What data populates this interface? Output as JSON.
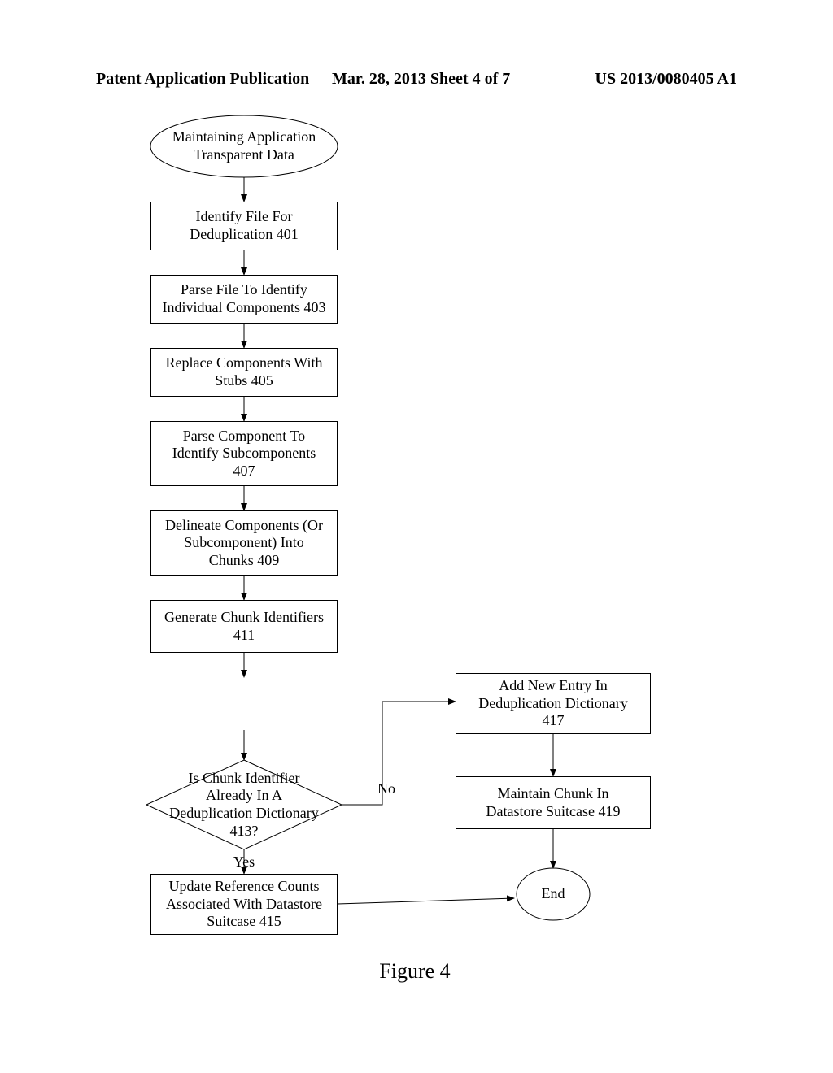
{
  "header": {
    "publication": "Patent Application Publication",
    "date_and_sheet": "Mar. 28, 2013  Sheet 4 of 7",
    "pubnum": "US 2013/0080405 A1"
  },
  "nodes": {
    "start": "Maintaining Application\nTransparent Data",
    "n401": "Identify File For\nDeduplication 401",
    "n403": "Parse File To Identify\nIndividual Components 403",
    "n405": "Replace Components With\nStubs 405",
    "n407": "Parse Component To\nIdentify Subcomponents\n407",
    "n409": "Delineate Components (Or\nSubcomponent) Into\nChunks 409",
    "n411": "Generate Chunk Identifiers\n411",
    "n413": "Is Chunk Identifier\nAlready In A\nDeduplication Dictionary\n413?",
    "n415": "Update Reference Counts\nAssociated With Datastore\nSuitcase 415",
    "n417": "Add New Entry In\nDeduplication Dictionary\n417",
    "n419": "Maintain Chunk In\nDatastore Suitcase 419",
    "end": "End"
  },
  "edges": {
    "no": "No",
    "yes": "Yes"
  },
  "caption": "Figure 4",
  "chart_data": {
    "type": "flowchart",
    "title": "Maintaining Application Transparent Data",
    "nodes": [
      {
        "id": "start",
        "shape": "terminator",
        "text": "Maintaining Application Transparent Data"
      },
      {
        "id": "401",
        "shape": "process",
        "text": "Identify File For Deduplication 401"
      },
      {
        "id": "403",
        "shape": "process",
        "text": "Parse File To Identify Individual Components 403"
      },
      {
        "id": "405",
        "shape": "process",
        "text": "Replace Components With Stubs 405"
      },
      {
        "id": "407",
        "shape": "process",
        "text": "Parse Component To Identify Subcomponents 407"
      },
      {
        "id": "409",
        "shape": "process",
        "text": "Delineate Components (Or Subcomponent) Into Chunks 409"
      },
      {
        "id": "411",
        "shape": "process",
        "text": "Generate Chunk Identifiers 411"
      },
      {
        "id": "413",
        "shape": "decision",
        "text": "Is Chunk Identifier Already In A Deduplication Dictionary 413?"
      },
      {
        "id": "415",
        "shape": "process",
        "text": "Update Reference Counts Associated With Datastore Suitcase 415"
      },
      {
        "id": "417",
        "shape": "process",
        "text": "Add New Entry In Deduplication Dictionary 417"
      },
      {
        "id": "419",
        "shape": "process",
        "text": "Maintain Chunk In Datastore Suitcase 419"
      },
      {
        "id": "end",
        "shape": "terminator",
        "text": "End"
      }
    ],
    "edges": [
      {
        "from": "start",
        "to": "401"
      },
      {
        "from": "401",
        "to": "403"
      },
      {
        "from": "403",
        "to": "405"
      },
      {
        "from": "405",
        "to": "407"
      },
      {
        "from": "407",
        "to": "409"
      },
      {
        "from": "409",
        "to": "411"
      },
      {
        "from": "411",
        "to": "413"
      },
      {
        "from": "413",
        "to": "415",
        "label": "Yes"
      },
      {
        "from": "413",
        "to": "417",
        "label": "No"
      },
      {
        "from": "417",
        "to": "419"
      },
      {
        "from": "419",
        "to": "end"
      },
      {
        "from": "415",
        "to": "end"
      }
    ]
  }
}
